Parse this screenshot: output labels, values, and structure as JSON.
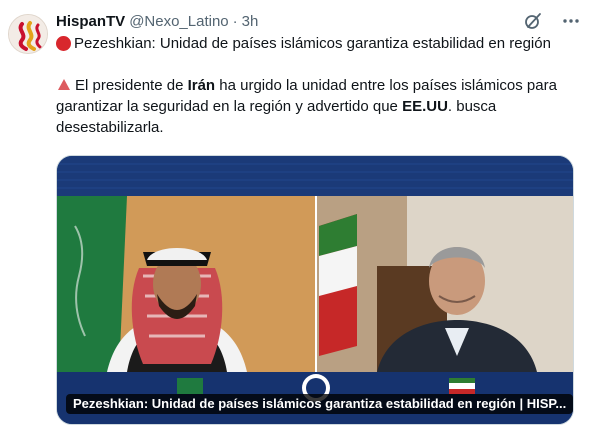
{
  "author": {
    "name": "HispanTV",
    "handle": "@Nexo_Latino",
    "separator": "·",
    "time": "3h"
  },
  "icons": {
    "avatar": "hispantv-logo",
    "grok": "grok-icon",
    "more": "more-icon",
    "headline_emoji": "red-circle-emoji",
    "body_emoji": "red-triangle-emoji"
  },
  "tweet": {
    "headline": "Pezeshkian: Unidad de países islámicos garantiza estabilidad en región",
    "body_1": "El presidente de ",
    "body_bold_1": "Irán",
    "body_2": " ha urgido la unidad entre los países islámicos para garantizar la seguridad en la región y advertido que ",
    "body_bold_2": "EE.UU",
    "body_3": ". busca desestabilizarla."
  },
  "media": {
    "caption": "Pezeshkian: Unidad de países islámicos garantiza estabilidad en región | HISP..."
  },
  "colors": {
    "text_primary": "#0f1419",
    "text_secondary": "#536471",
    "border": "#cfd9de",
    "media_banner": "#1b3a78",
    "emoji_red": "#d8272d",
    "brand": "#c8102e"
  }
}
